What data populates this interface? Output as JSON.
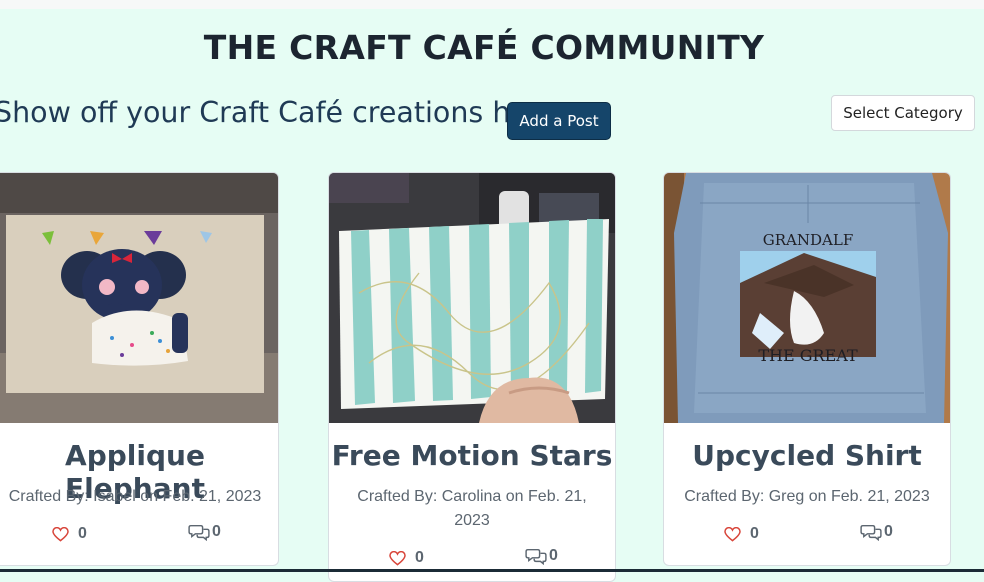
{
  "header": {
    "title": "THE CRAFT CAFÉ COMMUNITY"
  },
  "intro": {
    "text": "Show off your Craft Café creations here...",
    "add_post_label": "Add a Post"
  },
  "filter": {
    "select_category_label": "Select Category"
  },
  "posts": [
    {
      "title": "Applique Elephant",
      "byline": "Crafted By: Isabel on Feb. 21, 2023",
      "likes": "0",
      "comments": "0"
    },
    {
      "title": "Free Motion Stars",
      "byline": "Crafted By: Carolina on Feb. 21, 2023",
      "likes": "0",
      "comments": "0"
    },
    {
      "title": "Upcycled Shirt",
      "byline": "Crafted By: Greg on Feb. 21, 2023",
      "likes": "0",
      "comments": "0",
      "image_text": {
        "top": "GRANDALF",
        "bottom": "THE GREAT"
      }
    }
  ],
  "icons": {
    "like": "heart-outline-icon",
    "comment": "speech-bubbles-icon"
  },
  "colors": {
    "background": "#e6fdf4",
    "primary_button": "#15456a",
    "heart": "#d8453a",
    "title_text": "#1c2530"
  }
}
